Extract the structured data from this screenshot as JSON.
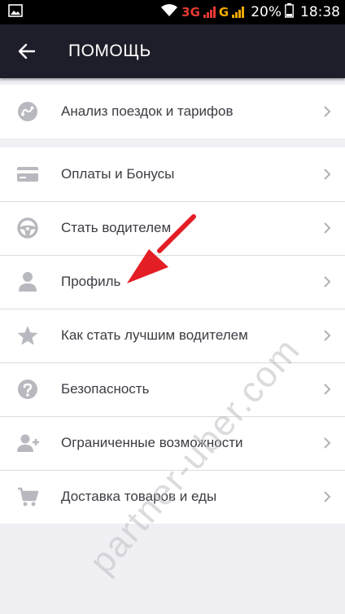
{
  "status_bar": {
    "network_1": "3G",
    "network_2": "G",
    "battery": "20%",
    "time": "18:38"
  },
  "app_bar": {
    "back_icon": "arrow-left-icon",
    "title": "ПОМОЩЬ"
  },
  "sections": [
    {
      "items": [
        {
          "icon": "trip-analysis-icon",
          "label": "Анализ поездок и тарифов"
        }
      ]
    },
    {
      "items": [
        {
          "icon": "card-icon",
          "label": "Оплаты и Бонусы"
        },
        {
          "icon": "steering-wheel-icon",
          "label": "Стать водителем"
        },
        {
          "icon": "person-icon",
          "label": "Профиль"
        },
        {
          "icon": "star-icon",
          "label": "Как стать лучшим водителем"
        },
        {
          "icon": "help-icon",
          "label": "Безопасность"
        },
        {
          "icon": "person-add-icon",
          "label": "Ограниченные возможности"
        },
        {
          "icon": "cart-icon",
          "label": "Доставка товаров и еды"
        }
      ]
    }
  ],
  "watermark": "partner-uber.com",
  "colors": {
    "app_bar": "#1e1e2a",
    "background": "#efeff4",
    "icon": "#b8b8bf",
    "annotation_arrow": "#e31e24"
  }
}
